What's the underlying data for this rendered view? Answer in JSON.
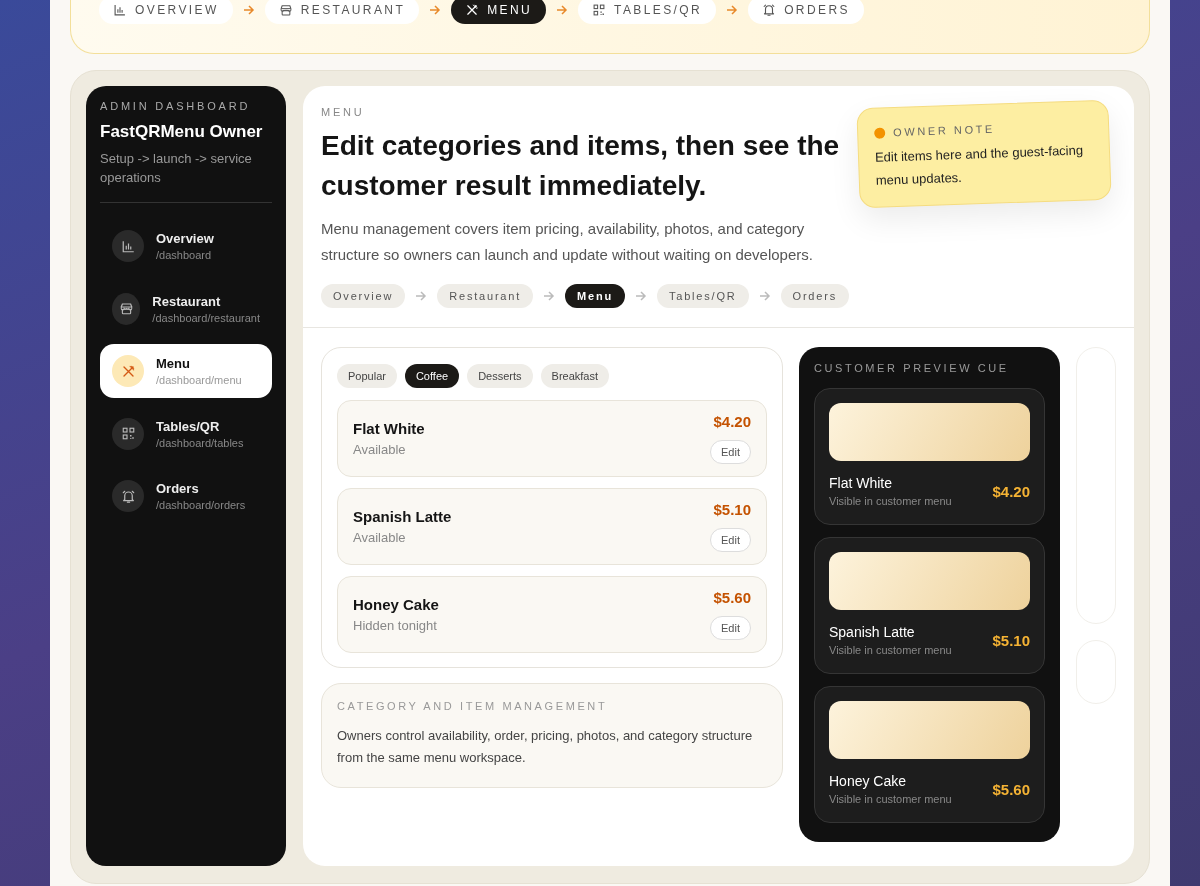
{
  "steps": [
    {
      "label": "OVERVIEW",
      "selected": false
    },
    {
      "label": "RESTAURANT",
      "selected": false
    },
    {
      "label": "MENU",
      "selected": true
    },
    {
      "label": "TABLES/QR",
      "selected": false
    },
    {
      "label": "ORDERS",
      "selected": false
    }
  ],
  "sidebar": {
    "eyebrow": "ADMIN DASHBOARD",
    "title": "FastQRMenu Owner",
    "subtitle": "Setup -> launch -> service operations",
    "items": [
      {
        "label": "Overview",
        "path": "/dashboard",
        "selected": false
      },
      {
        "label": "Restaurant",
        "path": "/dashboard/restaurant",
        "selected": false
      },
      {
        "label": "Menu",
        "path": "/dashboard/menu",
        "selected": true
      },
      {
        "label": "Tables/QR",
        "path": "/dashboard/tables",
        "selected": false
      },
      {
        "label": "Orders",
        "path": "/dashboard/orders",
        "selected": false
      }
    ]
  },
  "header": {
    "eyebrow": "MENU",
    "title": "Edit categories and items, then see the customer result immediately.",
    "description": "Menu management covers item pricing, availability, photos, and category structure so owners can launch and update without waiting on developers.",
    "steps": [
      {
        "label": "Overview",
        "selected": false
      },
      {
        "label": "Restaurant",
        "selected": false
      },
      {
        "label": "Menu",
        "selected": true
      },
      {
        "label": "Tables/QR",
        "selected": false
      },
      {
        "label": "Orders",
        "selected": false
      }
    ]
  },
  "note": {
    "title": "OWNER NOTE",
    "text": "Edit items here and the guest-facing menu updates."
  },
  "categories": [
    {
      "label": "Popular",
      "selected": false
    },
    {
      "label": "Coffee",
      "selected": true
    },
    {
      "label": "Desserts",
      "selected": false
    },
    {
      "label": "Breakfast",
      "selected": false
    }
  ],
  "items": [
    {
      "name": "Flat White",
      "status": "Available",
      "price": "$4.20",
      "action": "Edit"
    },
    {
      "name": "Spanish Latte",
      "status": "Available",
      "price": "$5.10",
      "action": "Edit"
    },
    {
      "name": "Honey Cake",
      "status": "Hidden tonight",
      "price": "$5.60",
      "action": "Edit"
    }
  ],
  "info": {
    "title": "CATEGORY AND ITEM MANAGEMENT",
    "text": "Owners control availability, order, pricing, photos, and category structure from the same menu workspace."
  },
  "preview": {
    "title": "CUSTOMER PREVIEW CUE",
    "items": [
      {
        "name": "Flat White",
        "caption": "Visible in customer menu",
        "price": "$4.20"
      },
      {
        "name": "Spanish Latte",
        "caption": "Visible in customer menu",
        "price": "$5.10"
      },
      {
        "name": "Honey Cake",
        "caption": "Visible in customer menu",
        "price": "$5.60"
      }
    ]
  }
}
